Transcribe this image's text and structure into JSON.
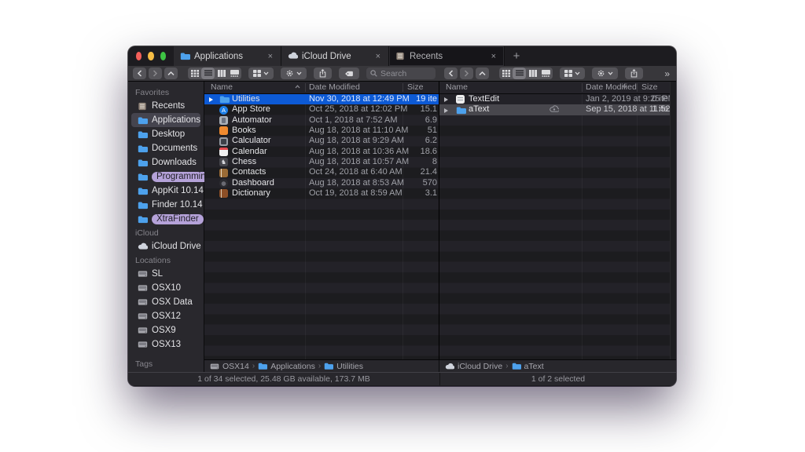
{
  "colors": {
    "selection_blue": "#0d5ad5",
    "selection_gray": "#48474d",
    "sidebar_pill": "#b5a2d9",
    "folder_blue": "#4da1ec"
  },
  "window": {
    "close_symbol": "×",
    "new_tab_label": "+",
    "tabs": [
      {
        "label": "Applications",
        "icon": "folder",
        "active": true
      },
      {
        "label": "iCloud Drive",
        "icon": "cloud",
        "active": true
      },
      {
        "label": "Recents",
        "icon": "recents",
        "active": false
      }
    ]
  },
  "toolbar": {
    "search_placeholder": "Search",
    "overflow_symbol": "»"
  },
  "sidebar": {
    "sections": [
      {
        "title": "Favorites",
        "items": [
          {
            "label": "Recents",
            "icon": "recents"
          },
          {
            "label": "Applications",
            "icon": "folder",
            "selected": true
          },
          {
            "label": "Desktop",
            "icon": "folder"
          },
          {
            "label": "Documents",
            "icon": "folder"
          },
          {
            "label": "Downloads",
            "icon": "folder"
          },
          {
            "label": "Programming",
            "icon": "folder",
            "pill": true
          },
          {
            "label": "AppKit 10.14",
            "icon": "folder"
          },
          {
            "label": "Finder 10.14",
            "icon": "folder"
          },
          {
            "label": "XtraFinder",
            "icon": "folder",
            "pill": true
          }
        ]
      },
      {
        "title": "iCloud",
        "items": [
          {
            "label": "iCloud Drive",
            "icon": "cloud"
          }
        ]
      },
      {
        "title": "Locations",
        "items": [
          {
            "label": "SL",
            "icon": "drive"
          },
          {
            "label": "OSX10",
            "icon": "drive"
          },
          {
            "label": "OSX Data",
            "icon": "drive"
          },
          {
            "label": "OSX12",
            "icon": "drive"
          },
          {
            "label": "OSX9",
            "icon": "drive"
          },
          {
            "label": "OSX13",
            "icon": "drive"
          }
        ]
      },
      {
        "title": "Tags",
        "items": [],
        "pinned_bottom": true
      }
    ]
  },
  "panes": [
    {
      "columns": [
        {
          "label": "Name",
          "sort": "asc"
        },
        {
          "label": "Date Modified",
          "sort": null
        },
        {
          "label": "Size",
          "sort": null
        }
      ],
      "rows": [
        {
          "name": "Utilities",
          "icon": "folder",
          "disclosure": true,
          "date": "Nov 30, 2018 at 12:49 PM",
          "size": "19 ite",
          "selected": "blue"
        },
        {
          "name": "App Store",
          "icon": "app-store",
          "disclosure": false,
          "date": "Oct 25, 2018 at 12:02 PM",
          "size": "15.1"
        },
        {
          "name": "Automator",
          "icon": "automator",
          "disclosure": false,
          "date": "Oct 1, 2018 at 7:52 AM",
          "size": "6.9"
        },
        {
          "name": "Books",
          "icon": "books",
          "disclosure": false,
          "date": "Aug 18, 2018 at 11:10 AM",
          "size": "51"
        },
        {
          "name": "Calculator",
          "icon": "calculator",
          "disclosure": false,
          "date": "Aug 18, 2018 at 9:29 AM",
          "size": "6.2"
        },
        {
          "name": "Calendar",
          "icon": "calendar",
          "disclosure": false,
          "date": "Aug 18, 2018 at 10:36 AM",
          "size": "18.6"
        },
        {
          "name": "Chess",
          "icon": "chess",
          "disclosure": false,
          "date": "Aug 18, 2018 at 10:57 AM",
          "size": "8"
        },
        {
          "name": "Contacts",
          "icon": "contacts",
          "disclosure": false,
          "date": "Oct 24, 2018 at 6:40 AM",
          "size": "21.4"
        },
        {
          "name": "Dashboard",
          "icon": "dashboard",
          "disclosure": false,
          "date": "Aug 18, 2018 at 8:53 AM",
          "size": "570"
        },
        {
          "name": "Dictionary",
          "icon": "dictionary",
          "disclosure": false,
          "date": "Oct 19, 2018 at 8:59 AM",
          "size": "3.1"
        }
      ],
      "path": [
        {
          "label": "OSX14",
          "icon": "drive"
        },
        {
          "label": "Applications",
          "icon": "folder"
        },
        {
          "label": "Utilities",
          "icon": "folder"
        }
      ],
      "path_separator": "›",
      "status": "1 of 34 selected, 25.48 GB available, 173.7 MB"
    },
    {
      "columns": [
        {
          "label": "Name",
          "sort": null
        },
        {
          "label": "Date Modified",
          "sort": "desc"
        },
        {
          "label": "Size",
          "sort": null
        }
      ],
      "rows": [
        {
          "name": "TextEdit",
          "icon": "textedit",
          "disclosure": true,
          "date": "Jan 2, 2019 at 9:25 PM",
          "size": "0 ite"
        },
        {
          "name": "aText",
          "icon": "folder",
          "disclosure": true,
          "cloud": true,
          "date": "Sep 15, 2018 at 11:52 AM",
          "size": "1 ite",
          "selected": "gray"
        }
      ],
      "path": [
        {
          "label": "iCloud Drive",
          "icon": "cloud"
        },
        {
          "label": "aText",
          "icon": "folder"
        }
      ],
      "path_separator": "›",
      "status": "1 of 2 selected"
    }
  ]
}
